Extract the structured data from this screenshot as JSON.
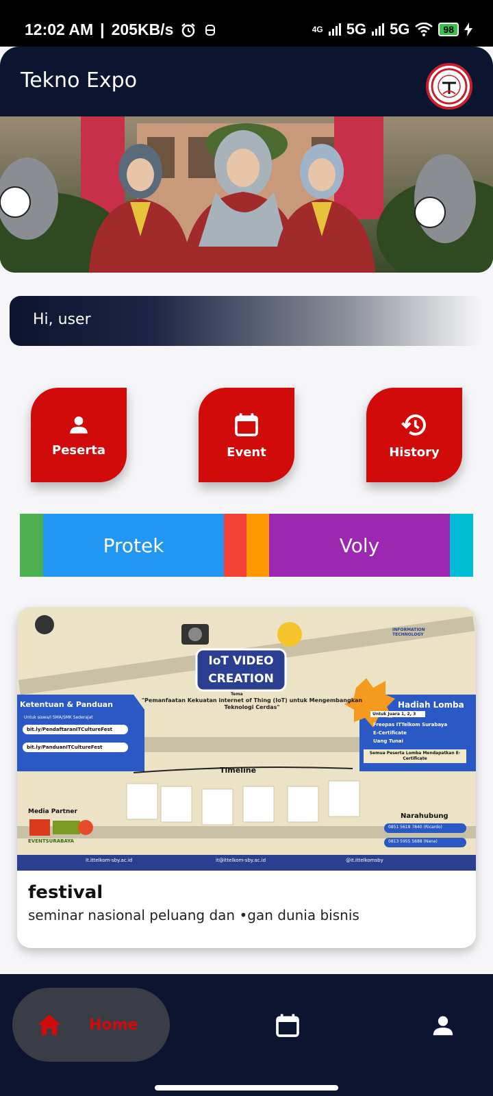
{
  "status_bar": {
    "time": "12:02 AM",
    "speed": "205KB/s",
    "net1": "5G",
    "net2": "5G",
    "net_small": "4G",
    "battery": "98"
  },
  "app_bar": {
    "title": "Tekno Expo"
  },
  "greeting": {
    "text": "Hi, user"
  },
  "menu": {
    "peserta": "Peserta",
    "event": "Event",
    "history": "History"
  },
  "tabs": [
    {
      "label": "",
      "color": "#4caf50"
    },
    {
      "label": "Protek",
      "color": "#2196f3"
    },
    {
      "label": "",
      "color": "#f44336"
    },
    {
      "label": "",
      "color": "#ff9800"
    },
    {
      "label": "Voly",
      "color": "#9c27b0"
    },
    {
      "label": "",
      "color": "#00bcd4"
    }
  ],
  "card": {
    "title": "festival",
    "subtitle": "seminar nasional peluang dan •gan dunia bisnis",
    "poster": {
      "headline_1": "IoT VIDEO",
      "headline_2": "CREATION",
      "tema": "Tema",
      "tema_text": "\"Pemanfaatan Kekuatan internet of Thing (IoT) untuk Mengembangkan Teknologi Cerdas\"",
      "left_title": "Ketentuan & Panduan",
      "left_note": "Untuk siswa/i SMA/SMK Sederajat",
      "link_1": "bit.ly/PendaftaranITCultureFest",
      "link_2": "bit.ly/PanduanITCultureFest",
      "right_title": "Hadiah Lomba",
      "right_sub": "Untuk Juara 1, 2, 3",
      "prize_1": "Freepas ITTelkom Surabaya",
      "prize_2": "E-Certificate",
      "prize_3": "Uang Tunai",
      "cert_note": "Semua Peserta Lomba Mendapatkan E-Certificate",
      "timeline": "Timeline",
      "media_partner": "Media Partner",
      "event_surabaya": "EVENTSURABAYA",
      "narahubung": "Narahubung",
      "contact_1": "0851 5618 7840 (Ricardo)",
      "contact_2": "0813 5955 5688 (Nana)",
      "footer_1": "it.ittelkom-sby.ac.id",
      "footer_2": "it@ittelkom-sby.ac.id",
      "footer_3": "@it.ittelkomsby",
      "it_badge": "INFORMATION TECHNOLOGY"
    }
  },
  "bottom_nav": {
    "home": "Home"
  }
}
